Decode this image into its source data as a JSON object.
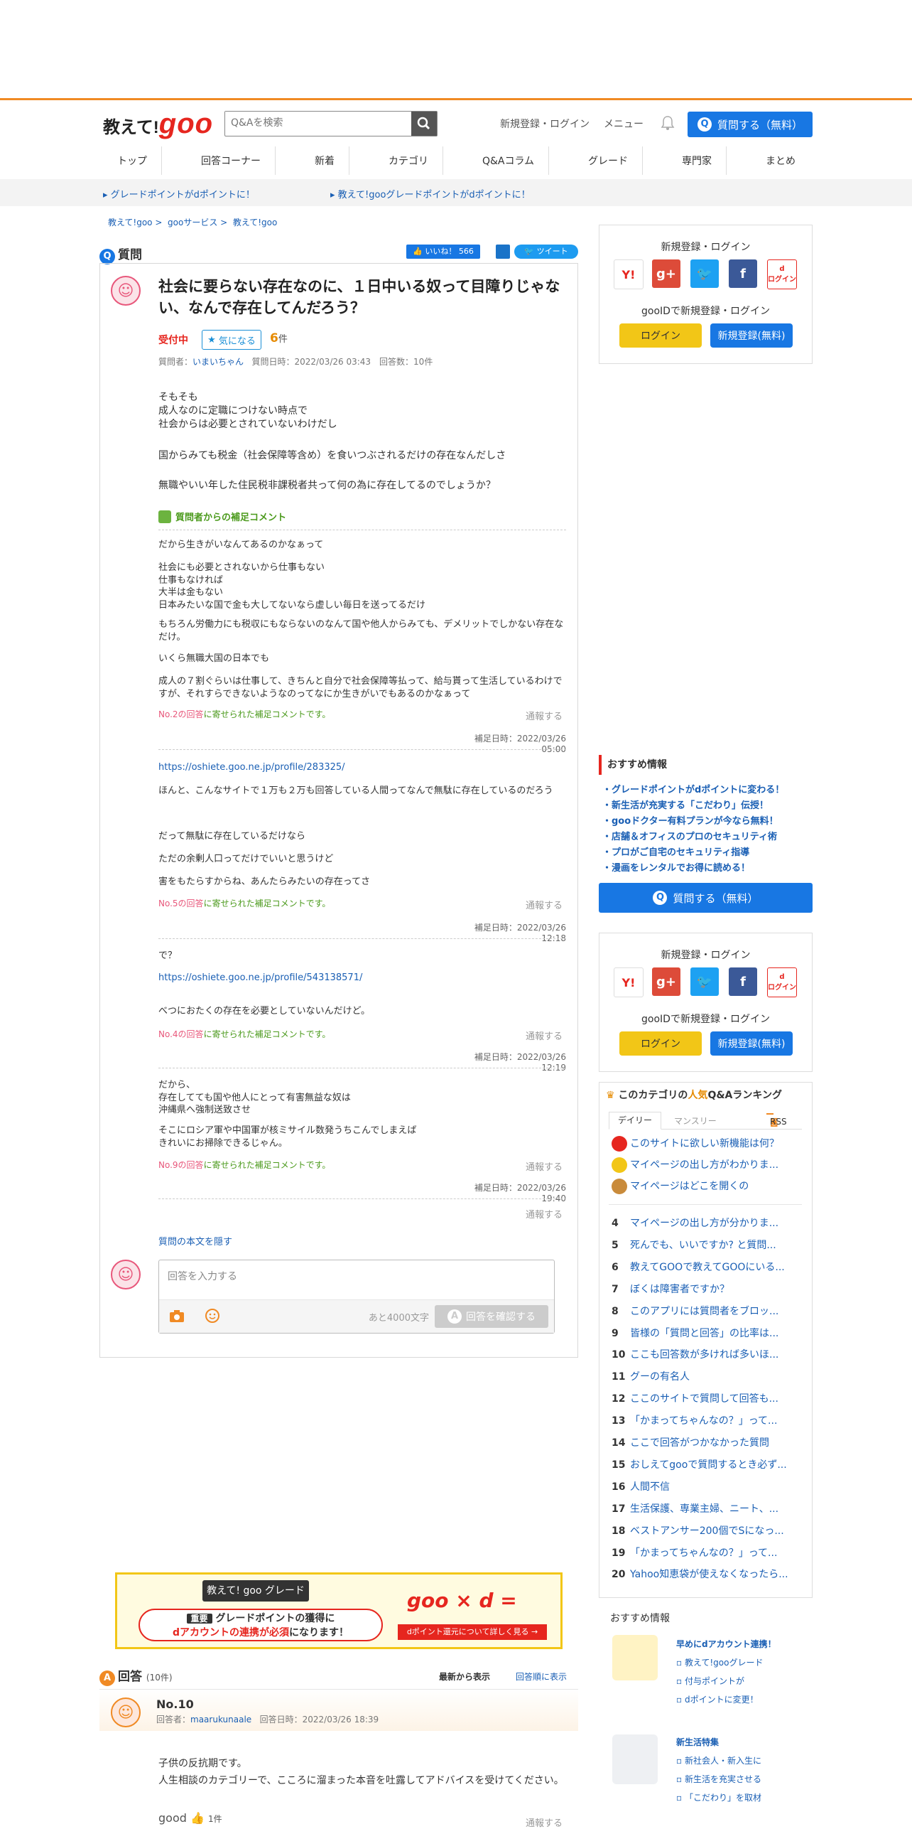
{
  "header": {
    "logo_a": "教えて!",
    "logo_b": "goo",
    "search_placeholder": "Q&Aを検索",
    "register_login": "新規登録・ログイン",
    "menu": "メニュー",
    "ask_button": "質問する（無料）"
  },
  "nav": [
    "トップ",
    "回答コーナー",
    "新着",
    "カテゴリ",
    "Q&Aコラム",
    "グレード",
    "専門家",
    "まとめ"
  ],
  "infobar": {
    "left": "グレードポイントがdポイントに！",
    "right": "教えて!gooグレードポイントがdポイントに！"
  },
  "breadcrumb": [
    "教えて!goo",
    "gooサービス",
    "教えて!goo"
  ],
  "question": {
    "section_label": "質問",
    "like_label": "いいね！",
    "like_count": "566",
    "tweet_label": "ツイート",
    "title": "社会に要らない存在なのに、１日中いる奴って目障りじゃない、なんで存在してんだろう？",
    "status": "受付中",
    "favorite_label": "気になる",
    "favorite_count": "6",
    "favorite_unit": "件",
    "meta_asker_label": "質問者：",
    "meta_asker": "いまいちゃん",
    "meta_rest": "質問日時：2022/03/26 03:43　回答数：10件",
    "body_1": "そもそも\n成人なのに定職につけない時点で\n社会からは必要とされていないわけだし",
    "body_2": "国からみても税金（社会保障等含め）を食いつぶされるだけの存在なんだしさ",
    "body_3": "無職やいい年した住民税非課税者共って何の為に存在してるのでしょうか？",
    "hojo_title": "質問者からの補足コメント",
    "c1_a": "だから生きがいなんてあるのかなぁって",
    "c1_b": "社会にも必要とされないから仕事もない\n仕事もなければ\n大半は金もない\n日本みたいな国で金も大してないなら虚しい毎日を送ってるだけ",
    "c1_c": "もちろん労働力にも税収にもならないのなんて国や他人からみても、デメリットでしかない存在なだけ。",
    "c1_d": "いくら無職大国の日本でも",
    "c1_e": "成人の７割ぐらいは仕事して、きちんと自分で社会保障等払って、給与貰って生活しているわけですが、それすらできないようなのってなにか生きがいでもあるのかなぁって",
    "c1_note_no": "No.2の回答",
    "c1_note": "に寄せられた補足コメントです。",
    "c1_ts": "補足日時：2022/03/26 05:00",
    "c2_link": "https://oshiete.goo.ne.jp/profile/283325/",
    "c2_a": "ほんと、こんなサイトで１万も２万も回答している人間ってなんで無駄に存在しているのだろう",
    "c2_b": "だって無駄に存在しているだけなら",
    "c2_c": "ただの余剰人口ってだけでいいと思うけど",
    "c2_d": "害をもたらすからね、あんたらみたいの存在ってさ",
    "c2_note_no": "No.5の回答",
    "c2_note": "に寄せられた補足コメントです。",
    "c2_ts": "補足日時：2022/03/26 12:18",
    "c3_a": "で？",
    "c3_link": "https://oshiete.goo.ne.jp/profile/543138571/",
    "c3_b": "べつにおたくの存在を必要としていないんだけど。",
    "c3_note_no": "No.4の回答",
    "c3_note": "に寄せられた補足コメントです。",
    "c3_ts": "補足日時：2022/03/26 12:19",
    "c4_a": "だから、\n存在してても国や他人にとって有害無益な奴は\n沖縄県へ強制送致させ",
    "c4_b": "そこにロシア軍や中国軍が核ミサイル数発うちこんでしまえば\nきれいにお掃除できるじゃん。",
    "c4_note_no": "No.9の回答",
    "c4_note": "に寄せられた補足コメントです。",
    "c4_ts": "補足日時：2022/03/26 19:40",
    "report": "通報する",
    "hide_body": "質問の本文を隠す",
    "answer_placeholder": "回答を入力する",
    "char_left": "あと4000文字",
    "confirm_button": "回答を確認する"
  },
  "banner": {
    "title": "教えて! goo グレード",
    "line1_tag": "重要",
    "line1": "グレードポイントの獲得に",
    "line2_red": "dアカウントの連携が必須",
    "line2": "になります！",
    "goo": "goo × d =",
    "dpoint": "dポイント還元について詳しく見る →"
  },
  "answers": {
    "label": "回答",
    "count": "(10件)",
    "sort_new": "最新から表示",
    "sort_old": "回答順に表示",
    "no": "No.10",
    "meta_label": "回答者：",
    "meta_user": "maarukunaale",
    "meta_time": "回答日時：2022/03/26 18:39",
    "body_a": "子供の反抗期です。",
    "body_b": "人生相談のカテゴリーで、こころに溜まった本音を吐露してアドバイスを受けてください。",
    "good": "good",
    "good_count": "1件",
    "report": "通報する"
  },
  "sidebar": {
    "login_title": "新規登録・ログイン",
    "gooid_title": "gooIDで新規登録・ログイン",
    "login": "ログイン",
    "register": "新規登録(無料)",
    "d_login": "ログイン",
    "recommend_title": "おすすめ情報",
    "recommend": [
      "・グレードポイントがdポイントに変わる！",
      "・新生活が充実する「こだわり」伝授！",
      "・gooドクター有料プランが今なら無料！",
      "・店舗＆オフィスのプロのセキュリティ術",
      "・プロがご自宅のセキュリティ指導",
      "・漫画をレンタルでお得に読める！"
    ],
    "ask_button": "質問する（無料）",
    "ranking_title_a": "このカテゴリの",
    "ranking_title_b": "人気",
    "ranking_title_c": "Q&Aランキング",
    "tab_daily": "デイリー",
    "tab_monthly": "マンスリー",
    "rss": "RSS",
    "ranking": [
      {
        "n": "1",
        "t": "このサイトに欲しい新機能は何？"
      },
      {
        "n": "2",
        "t": "マイページの出し方がわかりま..."
      },
      {
        "n": "3",
        "t": "マイページはどこを開くの"
      },
      {
        "n": "4",
        "t": "マイページの出し方が分かりま..."
      },
      {
        "n": "5",
        "t": "死んでも、いいですか? と質問..."
      },
      {
        "n": "6",
        "t": "教えてGOOで教えてGOOにいる..."
      },
      {
        "n": "7",
        "t": "ぼくは障害者ですか？"
      },
      {
        "n": "8",
        "t": "このアプリには質問者をブロッ..."
      },
      {
        "n": "9",
        "t": "皆様の「質問と回答」の比率は..."
      },
      {
        "n": "10",
        "t": "ここも回答数が多ければ多いほ..."
      },
      {
        "n": "11",
        "t": "グーの有名人"
      },
      {
        "n": "12",
        "t": "ここのサイトで質問して回答も..."
      },
      {
        "n": "13",
        "t": "「かまってちゃんなの？」って..."
      },
      {
        "n": "14",
        "t": "ここで回答がつかなかった質問"
      },
      {
        "n": "15",
        "t": "おしえてgooで質問するとき必ず..."
      },
      {
        "n": "16",
        "t": "人間不信"
      },
      {
        "n": "17",
        "t": "生活保護、専業主婦、ニート、..."
      },
      {
        "n": "18",
        "t": "ベストアンサー200個でSになっ..."
      },
      {
        "n": "19",
        "t": "「かまってちゃんなの？」って..."
      },
      {
        "n": "20",
        "t": "Yahoo知恵袋が使えなくなったら..."
      }
    ],
    "rec2_title": "おすすめ情報",
    "rec2_a_title": "早めにdアカウント連携！",
    "rec2_a": [
      "教えて!gooグレード",
      "付与ポイントが",
      "dポイントに変更！"
    ],
    "rec2_b_title": "新生活特集",
    "rec2_b": [
      "新社会人・新入生に",
      "新生活を充実させる",
      "「こだわり」を取材"
    ]
  },
  "colors": {
    "accent": "#1877e3",
    "brand": "#e6261f",
    "orange": "#f08a24"
  }
}
